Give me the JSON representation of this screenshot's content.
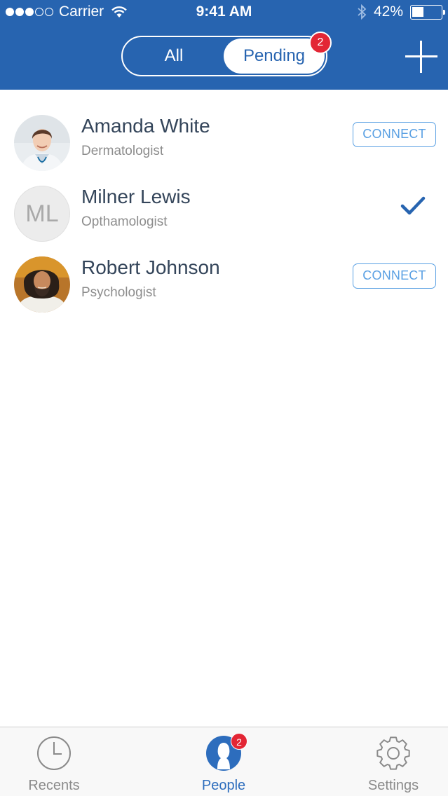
{
  "status_bar": {
    "carrier": "Carrier",
    "time": "9:41 AM",
    "battery": "42%",
    "battery_level": 0.42,
    "signal_bars_filled": 3,
    "signal_bars_total": 5
  },
  "header": {
    "segments": {
      "all_label": "All",
      "pending_label": "Pending",
      "selected": "Pending"
    },
    "pending_badge": "2",
    "add_icon": "plus-icon"
  },
  "contacts": [
    {
      "name": "Amanda White",
      "role": "Dermatologist",
      "action": "CONNECT",
      "avatar": "photo"
    },
    {
      "name": "Milner Lewis",
      "role": "Opthamologist",
      "initials": "ML",
      "action_icon": "checkmark-icon"
    },
    {
      "name": "Robert Johnson",
      "role": "Psychologist",
      "action": "CONNECT",
      "avatar": "photo"
    }
  ],
  "tabbar": {
    "recents": "Recents",
    "people": "People",
    "people_badge": "2",
    "settings": "Settings",
    "selected": "People"
  },
  "colors": {
    "brand": "#2764b0",
    "badge": "#e32635",
    "connect": "#5aa0e3",
    "active_tab": "#2d6dbd"
  }
}
